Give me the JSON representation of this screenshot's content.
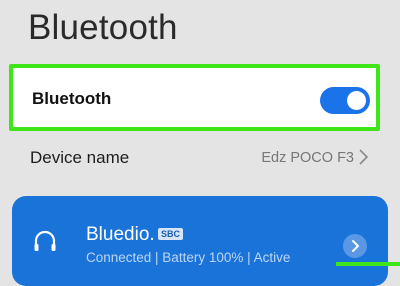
{
  "header": {
    "title": "Bluetooth"
  },
  "bluetooth_toggle": {
    "label": "Bluetooth",
    "state": "on",
    "accent_color": "#1a73e8",
    "highlight_color": "#3ee619"
  },
  "device_name": {
    "label": "Device name",
    "value": "Edz POCO F3",
    "chevron_icon": "chevron-right-icon"
  },
  "connected_device": {
    "icon": "headphones-icon",
    "name": "Bluedio.",
    "codec": "SBC",
    "status": "Connected | Battery 100% | Active",
    "details_icon": "chevron-right-icon",
    "card_color": "#1a73d9"
  }
}
